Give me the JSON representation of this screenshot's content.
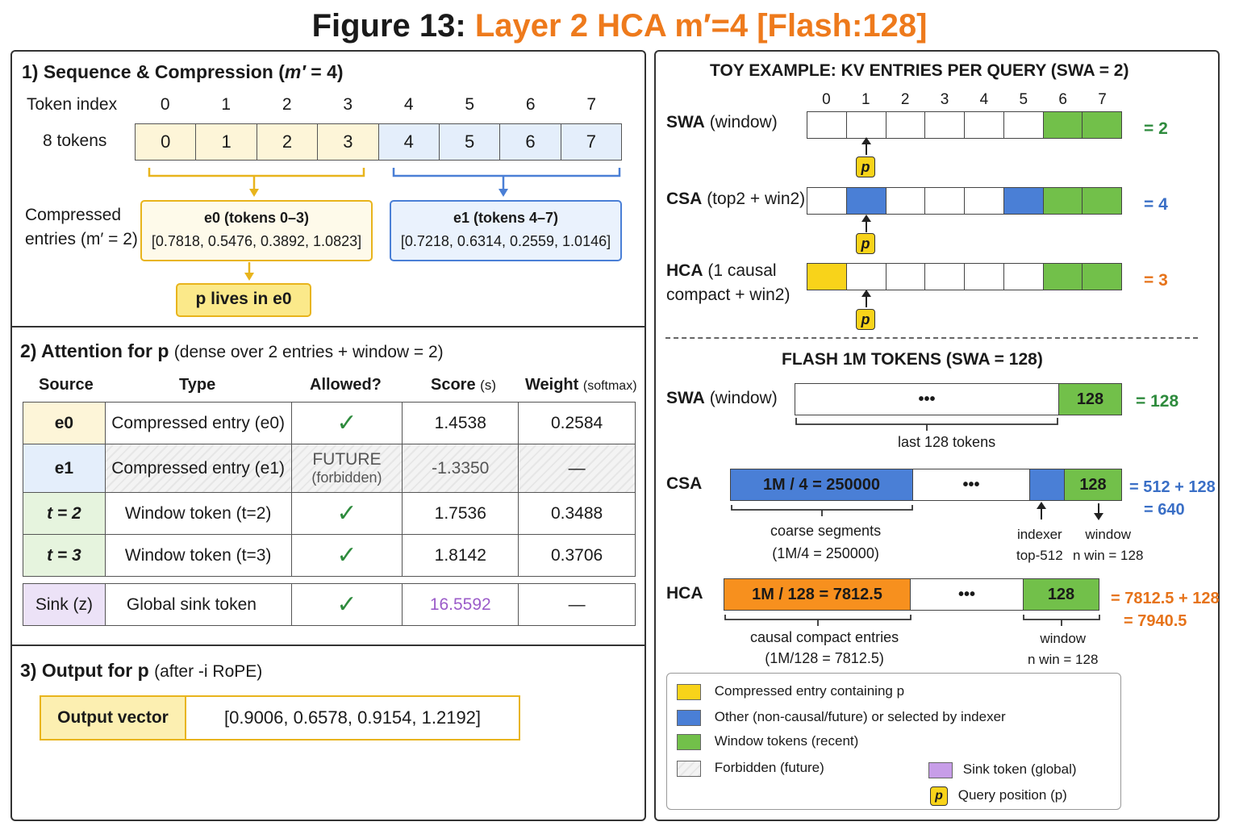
{
  "title": {
    "prefix": "Figure 13:",
    "accent": "Layer 2 HCA m′=4 [Flash:128]"
  },
  "colors": {
    "accent": "#ee7a1c",
    "yellow": "#f8d31a",
    "blue": "#4a7fd6",
    "green": "#72c04a",
    "orange": "#f7901e",
    "purple": "#b98ee0"
  },
  "s1": {
    "title": "1) Sequence & Compression (",
    "title_m": "m′",
    "title_end": " = 4)",
    "token_index_label": "Token index",
    "tokens_label": "8 tokens",
    "indices": [
      "0",
      "1",
      "2",
      "3",
      "4",
      "5",
      "6",
      "7"
    ],
    "compressed_label_1": "Compressed",
    "compressed_label_2": "entries (m′ = 2)",
    "e0_title": "e0 (tokens 0–3)",
    "e0_values": "[0.7818, 0.5476, 0.3892, 1.0823]",
    "e1_title": "e1 (tokens 4–7)",
    "e1_values": "[0.7218, 0.6314, 0.2559, 1.0146]",
    "p_lives": "p lives in e0"
  },
  "s2": {
    "title": "2) Attention for p",
    "subtitle": "(dense over 2 entries + window = 2)",
    "headers": {
      "source": "Source",
      "type": "Type",
      "allowed": "Allowed?",
      "score": "Score",
      "score_unit": "(s)",
      "weight": "Weight",
      "weight_unit": "(softmax)"
    },
    "rows": [
      {
        "source": "e0",
        "type": "Compressed entry (e0)",
        "allowed": "✓",
        "score": "1.4538",
        "weight": "0.2584"
      },
      {
        "source": "e1",
        "type": "Compressed entry (e1)",
        "allowed_1": "FUTURE",
        "allowed_2": "(forbidden)",
        "score": "-1.3350",
        "weight": "—"
      },
      {
        "source": "t = 2",
        "type": "Window token (t=2)",
        "allowed": "✓",
        "score": "1.7536",
        "weight": "0.3488"
      },
      {
        "source": "t = 3",
        "type": "Window token (t=3)",
        "allowed": "✓",
        "score": "1.8142",
        "weight": "0.3706"
      }
    ],
    "sink": {
      "source": "Sink (z)",
      "type": "Global sink token",
      "allowed": "✓",
      "score": "16.5592",
      "weight": "—"
    }
  },
  "s3": {
    "title": "3) Output for p",
    "subtitle": "(after -i RoPE)",
    "output_label": "Output vector",
    "output_value": "[0.9006, 0.6578, 0.9154, 1.2192]"
  },
  "toy": {
    "title": "TOY EXAMPLE: KV ENTRIES PER QUERY (SWA = 2)",
    "indices": [
      "0",
      "1",
      "2",
      "3",
      "4",
      "5",
      "6",
      "7"
    ],
    "swa_label": "SWA",
    "swa_sub": "(window)",
    "swa_eq": "= 2",
    "csa_label": "CSA",
    "csa_sub": "(top2 + win2)",
    "csa_eq": "= 4",
    "hca_label": "HCA",
    "hca_sub1": "(1 causal",
    "hca_sub2": "compact + win2)",
    "hca_eq": "= 3",
    "p": "p"
  },
  "flash": {
    "title": "FLASH 1M TOKENS (SWA = 128)",
    "swa_label": "SWA",
    "swa_sub": "(window)",
    "dots": "•••",
    "win": "128",
    "swa_eq": "= 128",
    "swa_note": "last 128 tokens",
    "csa_label": "CSA",
    "csa_seg": "1M / 4 = 250000",
    "csa_eq1": "= 512 + 128",
    "csa_eq2": "= 640",
    "csa_note1": "coarse segments",
    "csa_note2": "(1M/4 = 250000)",
    "indexer1": "indexer",
    "indexer2": "top-512",
    "window1": "window",
    "window2": "n win = 128",
    "hca_label": "HCA",
    "hca_seg": "1M / 128 = 7812.5",
    "hca_eq1": "= 7812.5 + 128",
    "hca_eq2": "= 7940.5",
    "hca_note1": "causal compact entries",
    "hca_note2": "(1M/128 = 7812.5)",
    "hwin1": "window",
    "hwin2": "n win = 128"
  },
  "legend": {
    "yellow": "Compressed entry containing p",
    "blue": "Other (non-causal/future) or selected by indexer",
    "green": "Window tokens (recent)",
    "hatch": "Forbidden (future)",
    "purple": "Sink token (global)",
    "query": "Query position (p)",
    "p": "p"
  }
}
